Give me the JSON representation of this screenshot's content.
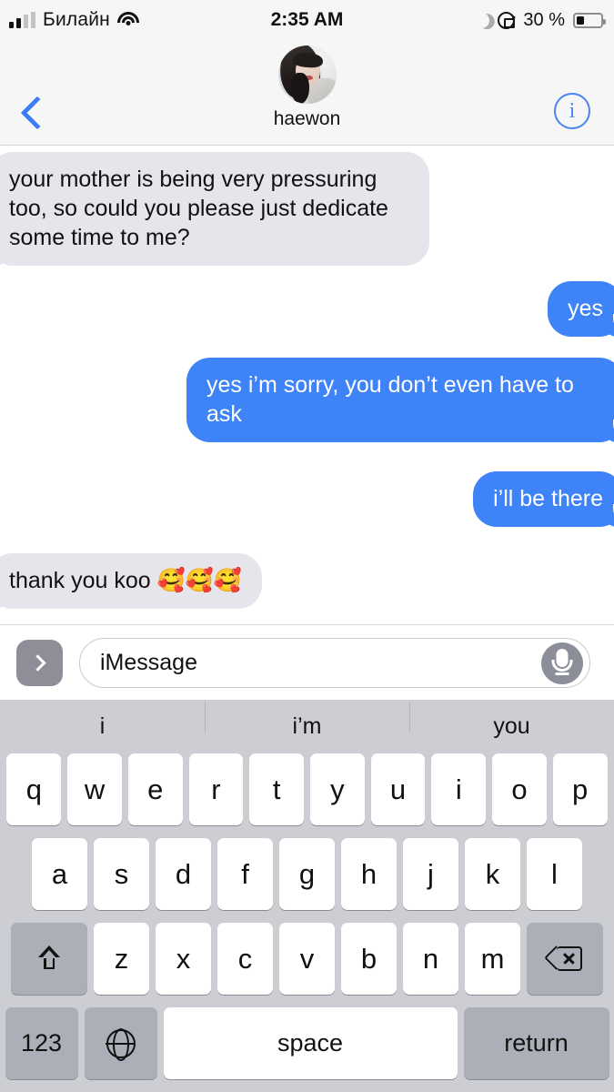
{
  "status_bar": {
    "carrier": "Билайн",
    "time": "2:35 AM",
    "battery_percent": "30 %",
    "battery_level": 30,
    "icons": [
      "signal-bars-icon",
      "wifi-icon",
      "moon-icon",
      "rotation-lock-icon",
      "battery-icon"
    ]
  },
  "nav_bar": {
    "back_label": "",
    "contact_name": "haewon",
    "info_label": "i"
  },
  "conversation": {
    "messages": [
      {
        "side": "in",
        "text": "your mother is being very pressuring too, so could you please just dedicate some time to me?"
      },
      {
        "side": "out",
        "text": "yes"
      },
      {
        "side": "out",
        "text": "yes i’m sorry, you don’t even have to ask"
      },
      {
        "side": "out",
        "text": "i’ll be there"
      },
      {
        "side": "in",
        "text": "thank you koo 🥰🥰🥰"
      }
    ]
  },
  "input_bar": {
    "apps_button": "›",
    "placeholder": "iMessage",
    "value": "",
    "mic_label": "microphone"
  },
  "keyboard": {
    "predictions": [
      "i",
      "i’m",
      "you"
    ],
    "row1": [
      "q",
      "w",
      "e",
      "r",
      "t",
      "y",
      "u",
      "i",
      "o",
      "p"
    ],
    "row2": [
      "a",
      "s",
      "d",
      "f",
      "g",
      "h",
      "j",
      "k",
      "l"
    ],
    "row3": [
      "z",
      "x",
      "c",
      "v",
      "b",
      "n",
      "m"
    ],
    "shift_label": "",
    "delete_label": "",
    "numbers_label": "123",
    "globe_label": "",
    "space_label": "space",
    "return_label": "return"
  },
  "colors": {
    "imessage_blue": "#3e83f8",
    "incoming_gray": "#e6e5eb",
    "keyboard_bg": "#ccced3",
    "key_white": "#ffffff",
    "key_gray": "#abafb8",
    "tint_blue": "#3b7df6"
  }
}
